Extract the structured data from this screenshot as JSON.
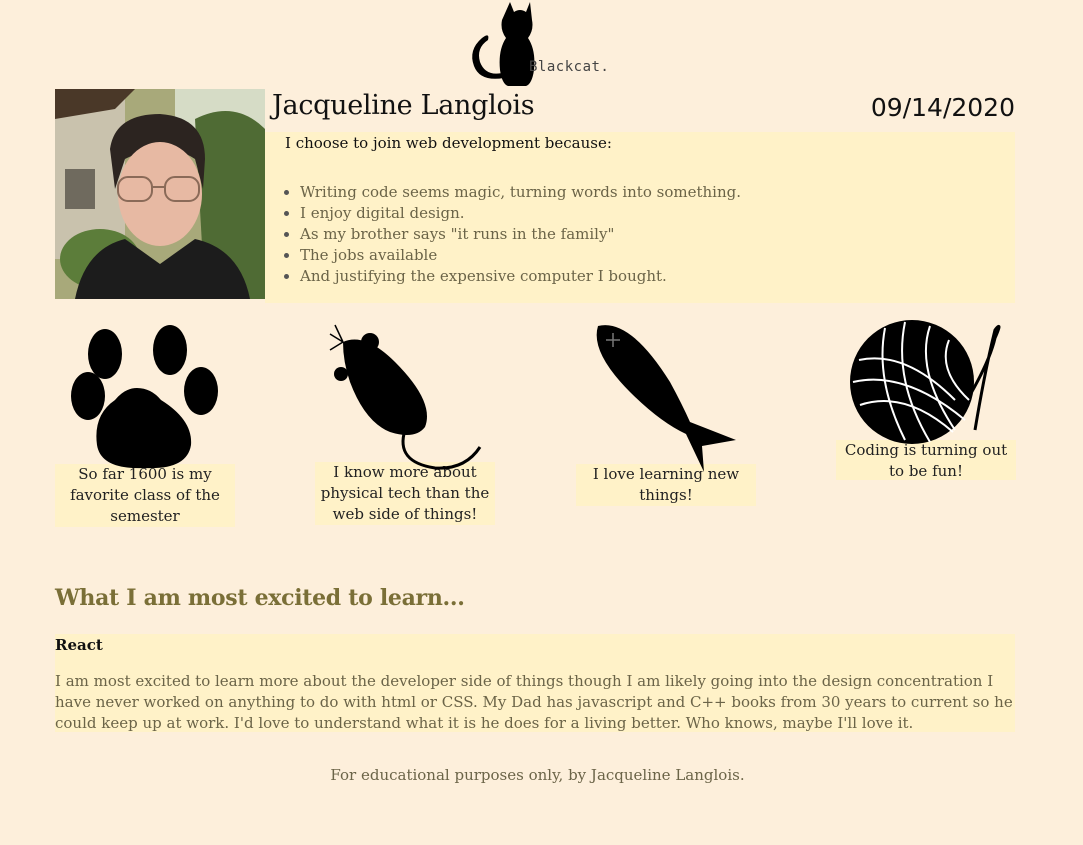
{
  "header": {
    "logo_text": "Blackcat.",
    "name": "Jacqueline Langlois",
    "date": "09/14/2020"
  },
  "reasons": {
    "title": "I choose to join web development because:",
    "items": [
      "Writing code seems magic, turning words into something.",
      "I enjoy digital design.",
      "As my brother says \"it runs in the family\"",
      "The jobs available",
      "And justifying the expensive computer I bought."
    ]
  },
  "cards": [
    {
      "icon": "paw-icon",
      "caption": "So far 1600 is my favorite class of the semester"
    },
    {
      "icon": "mouse-icon",
      "caption": "I know more about physical tech than the web side of things!"
    },
    {
      "icon": "fish-icon",
      "caption": "I love learning new things!"
    },
    {
      "icon": "yarn-ball-icon",
      "caption": "Coding is turning out to be fun!"
    }
  ],
  "excited": {
    "heading": "What I am most excited to learn...",
    "topic": "React",
    "body": "I am most excited to learn more about the developer side of things though I am likely going into the design concentration I have never worked on anything to do with html or CSS. My Dad has javascript and C++ books from 30 years to current so he could keep up at work. I'd love to understand what it is he does for a living better. Who knows, maybe I'll love it."
  },
  "footer": {
    "text": "For educational purposes only, by Jacqueline Langlois."
  }
}
